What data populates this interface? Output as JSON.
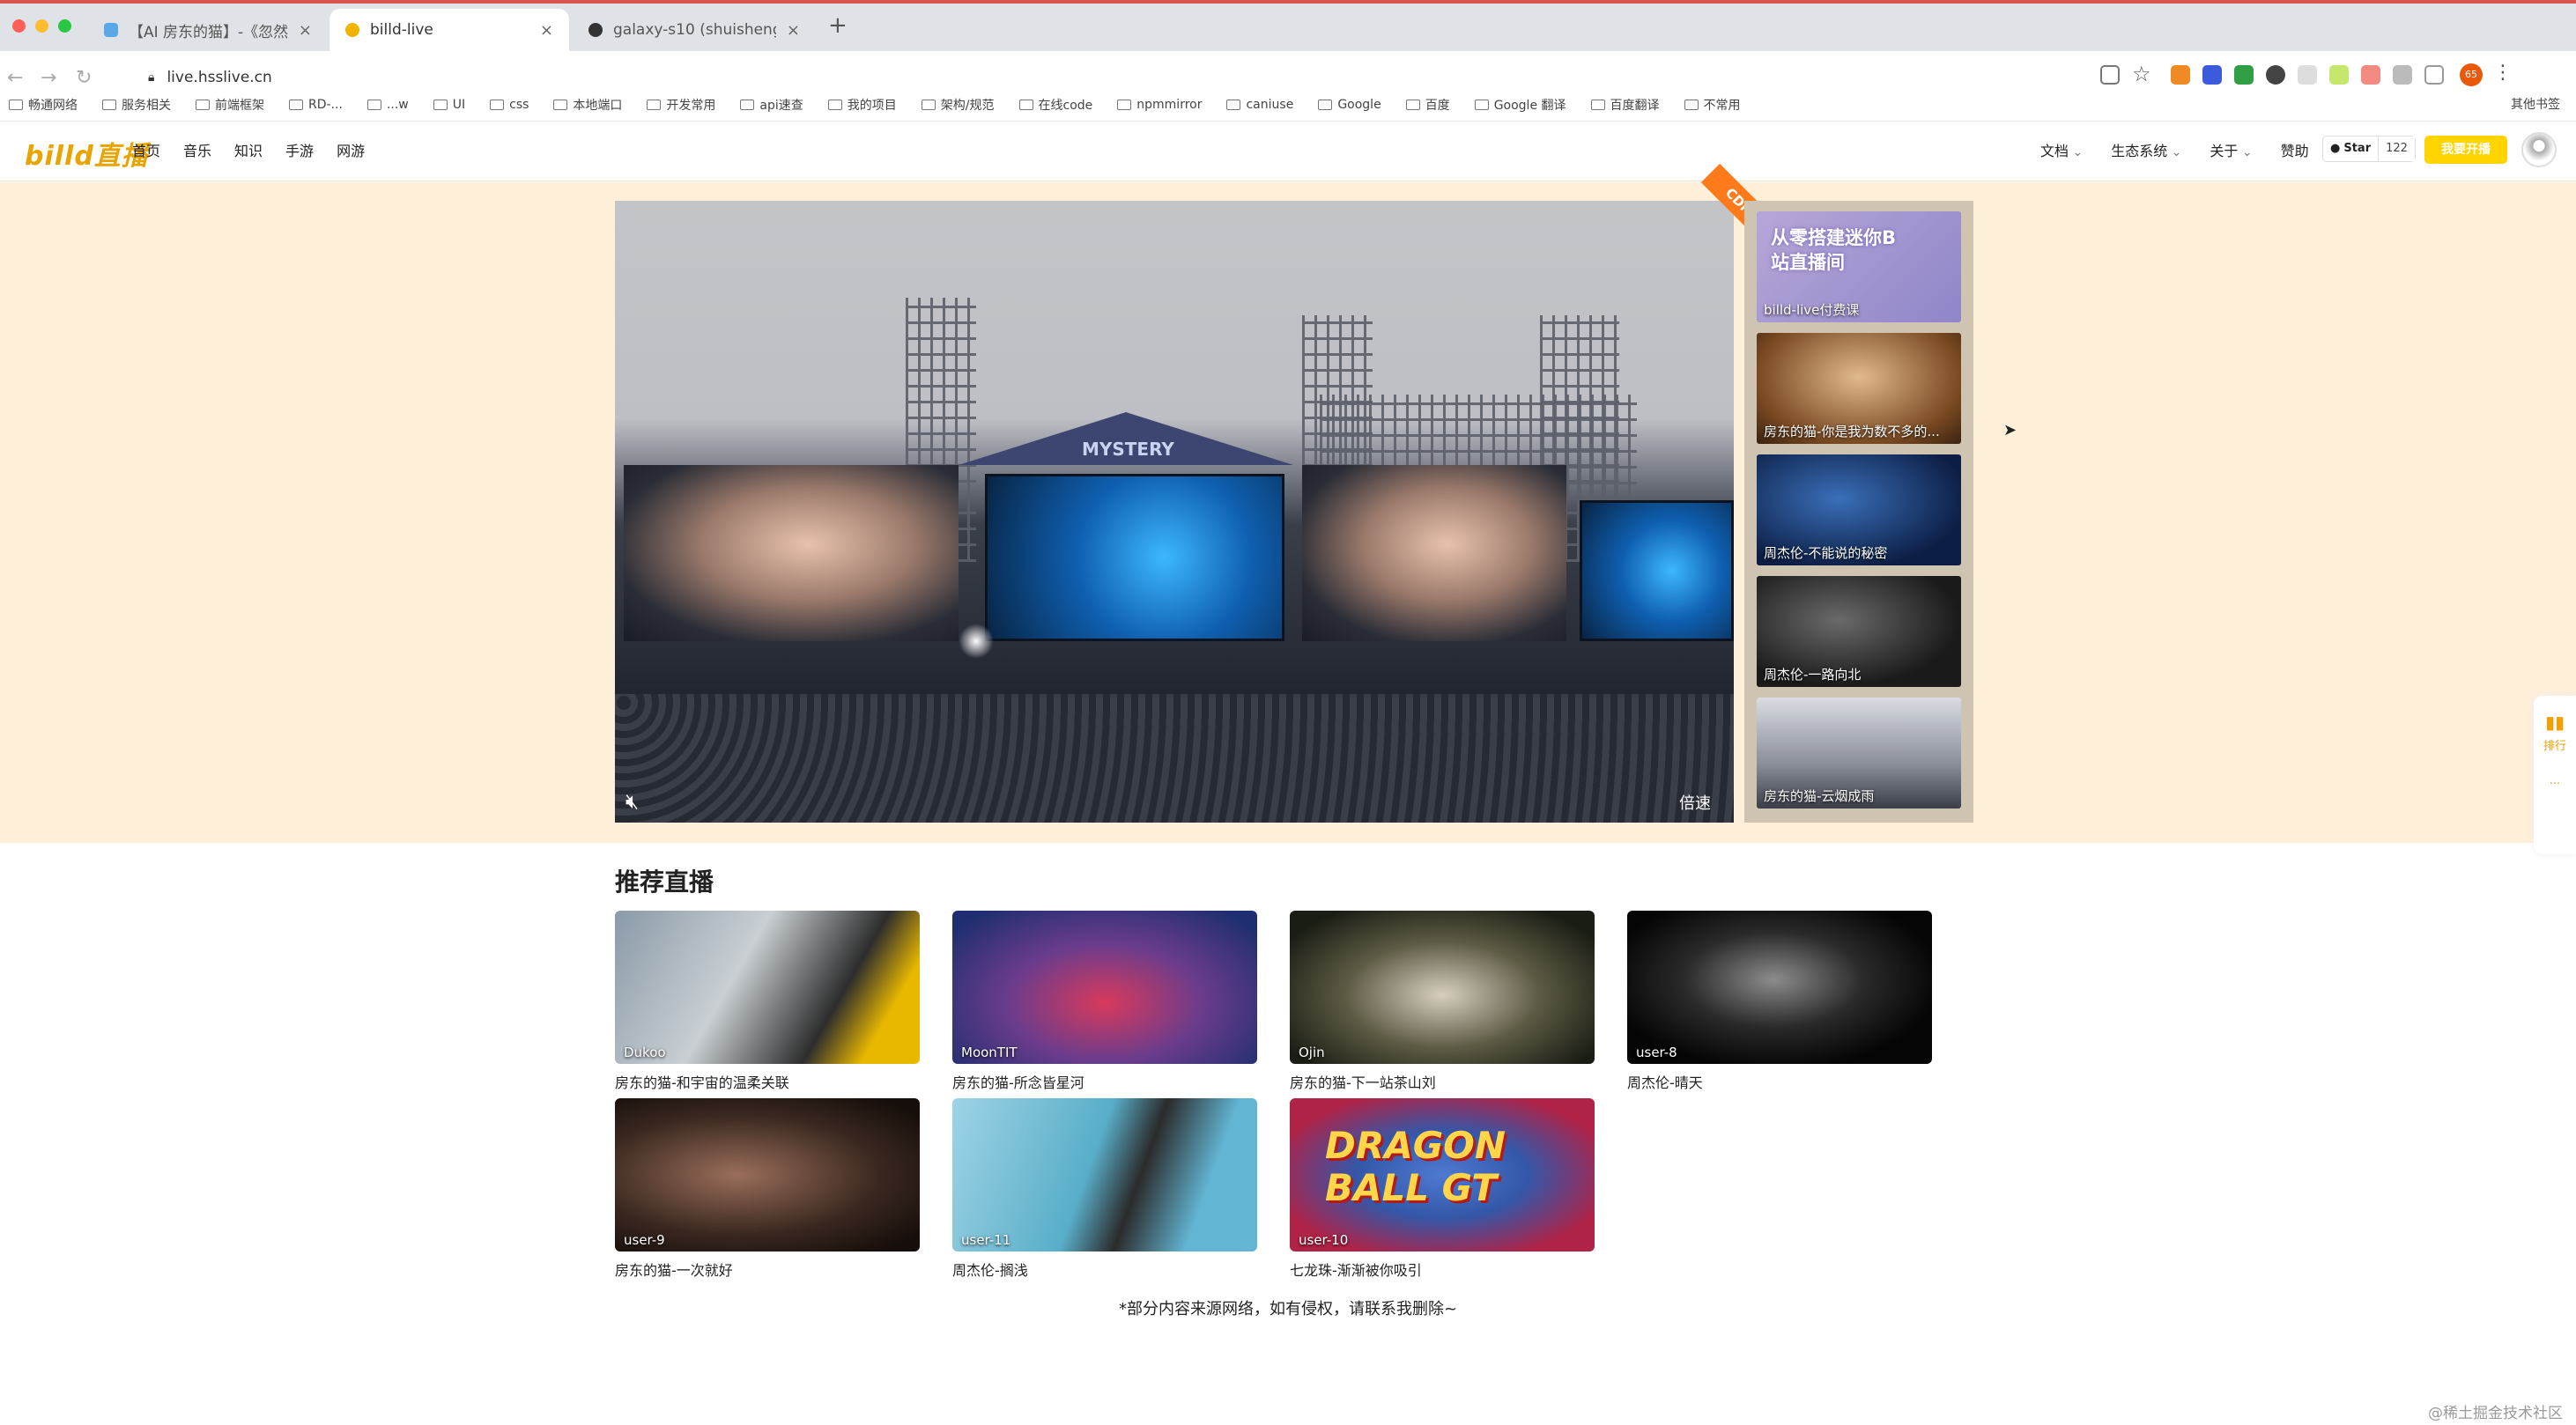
{
  "browser": {
    "tabs": [
      {
        "title": "【AI 房东的猫】-《忽然之间》"
      },
      {
        "title": "billd-live"
      },
      {
        "title": "galaxy-s10 (shuisheng)"
      }
    ],
    "new_tab": "+",
    "url": "live.hsslive.cn",
    "bookmarks": [
      "畅通网络",
      "服务相关",
      "前端框架",
      "RD-...",
      "...w",
      "UI",
      "css",
      "本地端口",
      "开发常用",
      "api速查",
      "我的项目",
      "架构/规范",
      "在线code",
      "npmmirror",
      "caniuse",
      "Google",
      "百度",
      "Google 翻译",
      "百度翻译",
      "不常用"
    ],
    "other_bookmarks": "其他书签",
    "profile_badge": "65"
  },
  "site": {
    "logo": "billd直播",
    "nav": [
      "首页",
      "音乐",
      "知识",
      "手游",
      "网游"
    ],
    "right_nav": [
      "文档",
      "生态系统",
      "关于",
      "赞助"
    ],
    "github": {
      "label": "Star",
      "count": "122"
    },
    "open_live": "我要开播",
    "player": {
      "badge": "CDN",
      "speed": "倍速",
      "stage_text": "MYSTERY"
    },
    "side_list": [
      {
        "title": "billd-live付费课",
        "overlay": "从零搭建迷你B站直播间"
      },
      {
        "title": "房东的猫-你是我为数不多的..."
      },
      {
        "title": "周杰伦-不能说的秘密"
      },
      {
        "title": "周杰伦-一路向北"
      },
      {
        "title": "房东的猫-云烟成雨"
      }
    ],
    "recommend_title": "推荐直播",
    "cards": [
      {
        "user": "Dukoo",
        "title": "房东的猫-和宇宙的温柔关联"
      },
      {
        "user": "MoonTIT",
        "title": "房东的猫-所念皆星河"
      },
      {
        "user": "Ojin",
        "title": "房东的猫-下一站茶山刘"
      },
      {
        "user": "user-8",
        "title": "周杰伦-晴天"
      },
      {
        "user": "user-9",
        "title": "房东的猫-一次就好"
      },
      {
        "user": "user-11",
        "title": "周杰伦-搁浅"
      },
      {
        "user": "user-10",
        "title": "七龙珠-渐渐被你吸引",
        "overlay": "DRAGON BALL GT"
      }
    ],
    "footer": "*部分内容来源网络，如有侵权，请联系我删除~",
    "right_tools": [
      "排行",
      "..."
    ]
  },
  "watermark": "@稀土掘金技术社区",
  "colors": {
    "accent": "#ffd400",
    "banner_bg": "#fdefd8",
    "cdn": "#ff7a1a"
  }
}
